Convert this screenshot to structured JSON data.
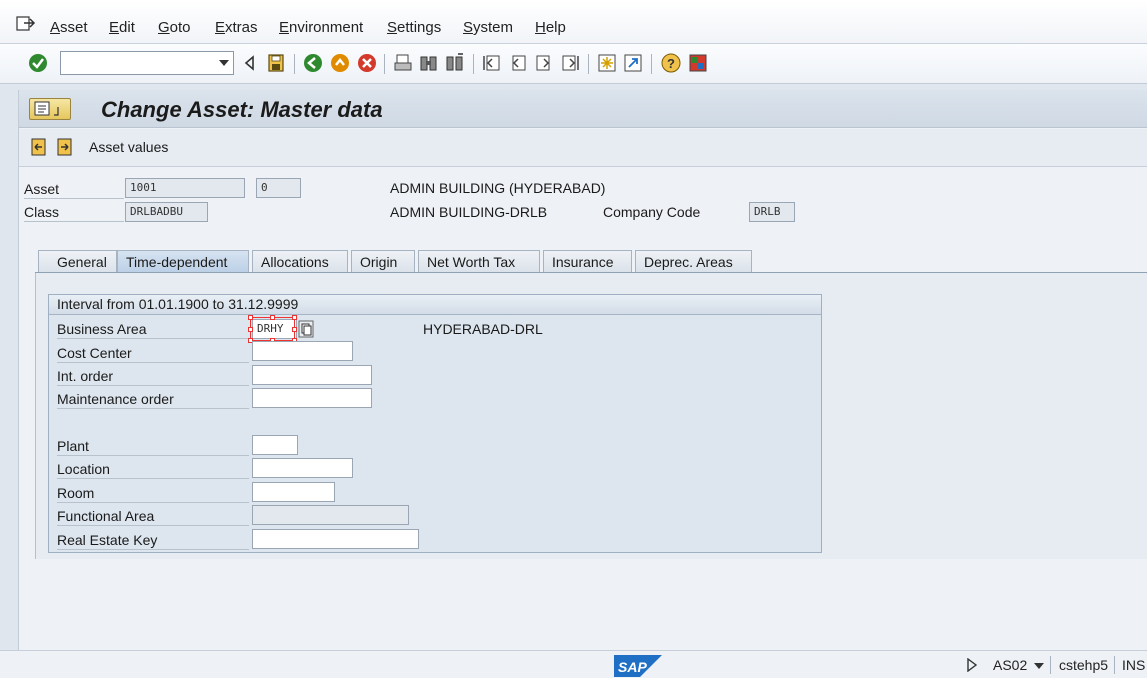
{
  "menu": {
    "items": [
      "Asset",
      "Edit",
      "Goto",
      "Extras",
      "Environment",
      "Settings",
      "System",
      "Help"
    ]
  },
  "toolbar": {
    "command_value": ""
  },
  "header": {
    "title": "Change Asset:  Master data"
  },
  "app_toolbar": {
    "asset_values_label": "Asset values"
  },
  "asset": {
    "asset_label": "Asset",
    "asset_number": "1001",
    "sub_number": "0",
    "description": "ADMIN BUILDING (HYDERABAD)",
    "class_label": "Class",
    "class_value": "DRLBADBU",
    "class_description": "ADMIN BUILDING-DRLB",
    "company_code_label": "Company Code",
    "company_code_value": "DRLB"
  },
  "tabs": [
    {
      "label": "General",
      "active": false
    },
    {
      "label": "Time-dependent",
      "active": true
    },
    {
      "label": "Allocations",
      "active": false
    },
    {
      "label": "Origin",
      "active": false
    },
    {
      "label": "Net Worth Tax",
      "active": false
    },
    {
      "label": "Insurance",
      "active": false
    },
    {
      "label": "Deprec. Areas",
      "active": false
    }
  ],
  "interval": {
    "header": "Interval from 01.01.1900 to 31.12.9999",
    "business_area_label": "Business Area",
    "business_area_value": "DRHY",
    "business_area_text": "HYDERABAD-DRL",
    "cost_center_label": "Cost Center",
    "cost_center_value": "",
    "int_order_label": "Int. order",
    "int_order_value": "",
    "maintenance_order_label": "Maintenance order",
    "maintenance_order_value": "",
    "plant_label": "Plant",
    "plant_value": "",
    "location_label": "Location",
    "location_value": "",
    "room_label": "Room",
    "room_value": "",
    "functional_area_label": "Functional Area",
    "functional_area_value": "",
    "real_estate_key_label": "Real Estate Key",
    "real_estate_key_value": ""
  },
  "status": {
    "transaction": "AS02",
    "server": "cstehp5",
    "mode": "INS",
    "logo_text": "SAP"
  },
  "colors": {
    "sap_blue": "#1f6fc5",
    "ok_green": "#2f8a2f",
    "exit_orange": "#e08a00",
    "cancel_red": "#d33a2c",
    "selection_red": "#ee3333"
  }
}
